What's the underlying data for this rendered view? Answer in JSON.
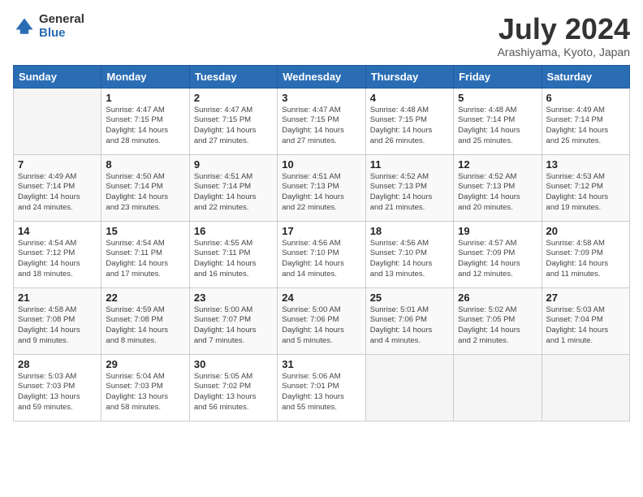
{
  "header": {
    "logo_general": "General",
    "logo_blue": "Blue",
    "month_title": "July 2024",
    "location": "Arashiyama, Kyoto, Japan"
  },
  "days_of_week": [
    "Sunday",
    "Monday",
    "Tuesday",
    "Wednesday",
    "Thursday",
    "Friday",
    "Saturday"
  ],
  "weeks": [
    [
      {
        "day": "",
        "info": ""
      },
      {
        "day": "1",
        "info": "Sunrise: 4:47 AM\nSunset: 7:15 PM\nDaylight: 14 hours\nand 28 minutes."
      },
      {
        "day": "2",
        "info": "Sunrise: 4:47 AM\nSunset: 7:15 PM\nDaylight: 14 hours\nand 27 minutes."
      },
      {
        "day": "3",
        "info": "Sunrise: 4:47 AM\nSunset: 7:15 PM\nDaylight: 14 hours\nand 27 minutes."
      },
      {
        "day": "4",
        "info": "Sunrise: 4:48 AM\nSunset: 7:15 PM\nDaylight: 14 hours\nand 26 minutes."
      },
      {
        "day": "5",
        "info": "Sunrise: 4:48 AM\nSunset: 7:14 PM\nDaylight: 14 hours\nand 25 minutes."
      },
      {
        "day": "6",
        "info": "Sunrise: 4:49 AM\nSunset: 7:14 PM\nDaylight: 14 hours\nand 25 minutes."
      }
    ],
    [
      {
        "day": "7",
        "info": "Sunrise: 4:49 AM\nSunset: 7:14 PM\nDaylight: 14 hours\nand 24 minutes."
      },
      {
        "day": "8",
        "info": "Sunrise: 4:50 AM\nSunset: 7:14 PM\nDaylight: 14 hours\nand 23 minutes."
      },
      {
        "day": "9",
        "info": "Sunrise: 4:51 AM\nSunset: 7:14 PM\nDaylight: 14 hours\nand 22 minutes."
      },
      {
        "day": "10",
        "info": "Sunrise: 4:51 AM\nSunset: 7:13 PM\nDaylight: 14 hours\nand 22 minutes."
      },
      {
        "day": "11",
        "info": "Sunrise: 4:52 AM\nSunset: 7:13 PM\nDaylight: 14 hours\nand 21 minutes."
      },
      {
        "day": "12",
        "info": "Sunrise: 4:52 AM\nSunset: 7:13 PM\nDaylight: 14 hours\nand 20 minutes."
      },
      {
        "day": "13",
        "info": "Sunrise: 4:53 AM\nSunset: 7:12 PM\nDaylight: 14 hours\nand 19 minutes."
      }
    ],
    [
      {
        "day": "14",
        "info": "Sunrise: 4:54 AM\nSunset: 7:12 PM\nDaylight: 14 hours\nand 18 minutes."
      },
      {
        "day": "15",
        "info": "Sunrise: 4:54 AM\nSunset: 7:11 PM\nDaylight: 14 hours\nand 17 minutes."
      },
      {
        "day": "16",
        "info": "Sunrise: 4:55 AM\nSunset: 7:11 PM\nDaylight: 14 hours\nand 16 minutes."
      },
      {
        "day": "17",
        "info": "Sunrise: 4:56 AM\nSunset: 7:10 PM\nDaylight: 14 hours\nand 14 minutes."
      },
      {
        "day": "18",
        "info": "Sunrise: 4:56 AM\nSunset: 7:10 PM\nDaylight: 14 hours\nand 13 minutes."
      },
      {
        "day": "19",
        "info": "Sunrise: 4:57 AM\nSunset: 7:09 PM\nDaylight: 14 hours\nand 12 minutes."
      },
      {
        "day": "20",
        "info": "Sunrise: 4:58 AM\nSunset: 7:09 PM\nDaylight: 14 hours\nand 11 minutes."
      }
    ],
    [
      {
        "day": "21",
        "info": "Sunrise: 4:58 AM\nSunset: 7:08 PM\nDaylight: 14 hours\nand 9 minutes."
      },
      {
        "day": "22",
        "info": "Sunrise: 4:59 AM\nSunset: 7:08 PM\nDaylight: 14 hours\nand 8 minutes."
      },
      {
        "day": "23",
        "info": "Sunrise: 5:00 AM\nSunset: 7:07 PM\nDaylight: 14 hours\nand 7 minutes."
      },
      {
        "day": "24",
        "info": "Sunrise: 5:00 AM\nSunset: 7:06 PM\nDaylight: 14 hours\nand 5 minutes."
      },
      {
        "day": "25",
        "info": "Sunrise: 5:01 AM\nSunset: 7:06 PM\nDaylight: 14 hours\nand 4 minutes."
      },
      {
        "day": "26",
        "info": "Sunrise: 5:02 AM\nSunset: 7:05 PM\nDaylight: 14 hours\nand 2 minutes."
      },
      {
        "day": "27",
        "info": "Sunrise: 5:03 AM\nSunset: 7:04 PM\nDaylight: 14 hours\nand 1 minute."
      }
    ],
    [
      {
        "day": "28",
        "info": "Sunrise: 5:03 AM\nSunset: 7:03 PM\nDaylight: 13 hours\nand 59 minutes."
      },
      {
        "day": "29",
        "info": "Sunrise: 5:04 AM\nSunset: 7:03 PM\nDaylight: 13 hours\nand 58 minutes."
      },
      {
        "day": "30",
        "info": "Sunrise: 5:05 AM\nSunset: 7:02 PM\nDaylight: 13 hours\nand 56 minutes."
      },
      {
        "day": "31",
        "info": "Sunrise: 5:06 AM\nSunset: 7:01 PM\nDaylight: 13 hours\nand 55 minutes."
      },
      {
        "day": "",
        "info": ""
      },
      {
        "day": "",
        "info": ""
      },
      {
        "day": "",
        "info": ""
      }
    ]
  ]
}
